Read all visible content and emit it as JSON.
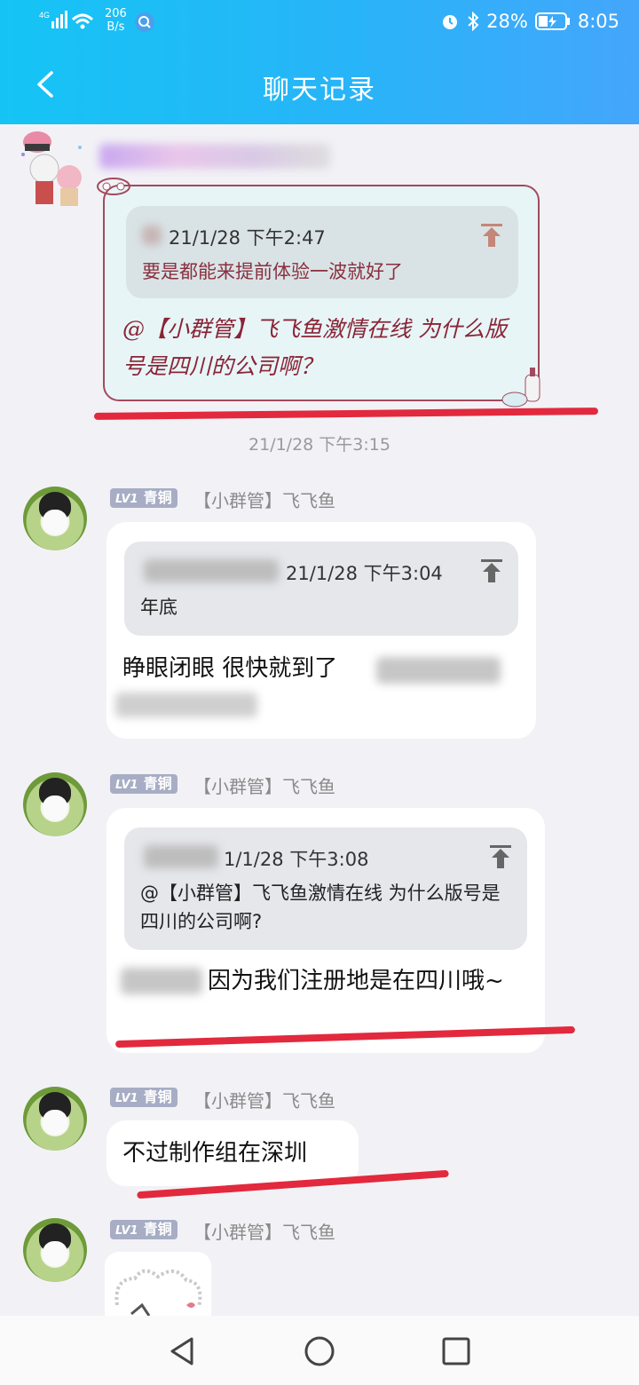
{
  "status_bar": {
    "network": "4G",
    "speed_value": "206",
    "speed_unit": "B/s",
    "battery": "28%",
    "time": "8:05"
  },
  "header": {
    "title": "聊天记录"
  },
  "messages": [
    {
      "quote_time": "21/1/28 下午2:47",
      "quote_text": "要是都能来提前体验一波就好了",
      "body": "@【小群管】飞飞鱼激情在线 为什么版号是四川的公司啊？"
    },
    {
      "level": "LV1",
      "rank": "青铜",
      "nickname": "【小群管】飞飞鱼",
      "quote_time": "21/1/28 下午3:04",
      "quote_text": "年底",
      "body": "睁眼闭眼 很快就到了"
    },
    {
      "level": "LV1",
      "rank": "青铜",
      "nickname": "【小群管】飞飞鱼",
      "quote_time": "1/1/28 下午3:08",
      "quote_text": "@【小群管】飞飞鱼激情在线 为什么版号是四川的公司啊?",
      "body": "因为我们注册地是在四川哦~"
    },
    {
      "level": "LV1",
      "rank": "青铜",
      "nickname": "【小群管】飞飞鱼",
      "body": "不过制作组在深圳"
    },
    {
      "level": "LV1",
      "rank": "青铜",
      "nickname": "【小群管】飞飞鱼"
    }
  ],
  "timestamp": "21/1/28 下午3:15"
}
